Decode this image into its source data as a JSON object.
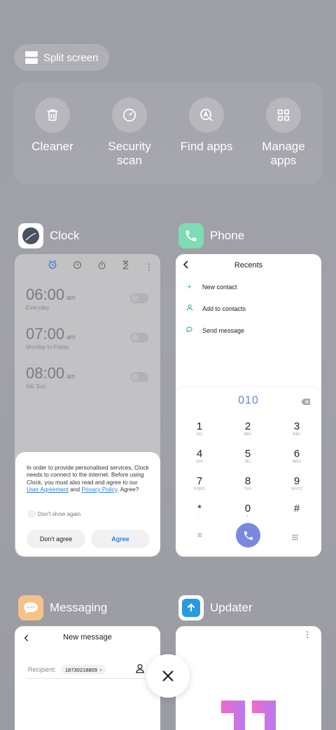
{
  "split_screen": {
    "label": "Split screen",
    "icon": "split-screen-icon"
  },
  "quick_actions": [
    {
      "label": "Cleaner",
      "icon": "trash-icon"
    },
    {
      "label": "Security\nscan",
      "line1": "Security",
      "line2": "scan",
      "icon": "security-scan-icon"
    },
    {
      "label": "Find apps",
      "icon": "find-apps-icon"
    },
    {
      "label": "Manage\napps",
      "line1": "Manage",
      "line2": "apps",
      "icon": "grid-icon"
    }
  ],
  "apps": {
    "clock": {
      "name": "Clock",
      "alarms": [
        {
          "time": "06:00",
          "ampm": "am",
          "days": "Everyday"
        },
        {
          "time": "07:00",
          "ampm": "am",
          "days": "Monday to Friday"
        },
        {
          "time": "08:00",
          "ampm": "am",
          "days": "Sat Sun"
        }
      ],
      "dialog": {
        "text_before": "In order to provide personalised services, Clock needs to connect to the internet. Before using Clock, you must also read and agree to our ",
        "link1": "User Agreement",
        "and": " and ",
        "link2": "Privacy Policy",
        "text_after": ". Agree?",
        "dont_show": "Don't show again",
        "disagree": "Don't agree",
        "agree": "Agree"
      }
    },
    "phone": {
      "name": "Phone",
      "title": "Recents",
      "rows": [
        "New contact",
        "Add to contacts",
        "Send message"
      ],
      "dial_number": "010",
      "keys": [
        {
          "num": "1",
          "let": "QO"
        },
        {
          "num": "2",
          "let": "ABC"
        },
        {
          "num": "3",
          "let": "DEF"
        },
        {
          "num": "4",
          "let": "GHI"
        },
        {
          "num": "5",
          "let": "JKL"
        },
        {
          "num": "6",
          "let": "MNO"
        },
        {
          "num": "7",
          "let": "PQRS"
        },
        {
          "num": "8",
          "let": "TUV"
        },
        {
          "num": "9",
          "let": "WXYZ"
        },
        {
          "num": "*",
          "let": ","
        },
        {
          "num": "0",
          "let": "+"
        },
        {
          "num": "#",
          "let": ""
        }
      ]
    },
    "messaging": {
      "name": "Messaging",
      "title": "New message",
      "recipient_label": "Recipient:",
      "recipient_value": "18730218809"
    },
    "updater": {
      "name": "Updater"
    }
  },
  "colors": {
    "accent_blue": "#2a7fe0",
    "dial_purple": "#7b88e0",
    "phone_green": "#25b089",
    "messaging_orange": "#f6c287",
    "updater_blue": "#2a9ae0"
  }
}
